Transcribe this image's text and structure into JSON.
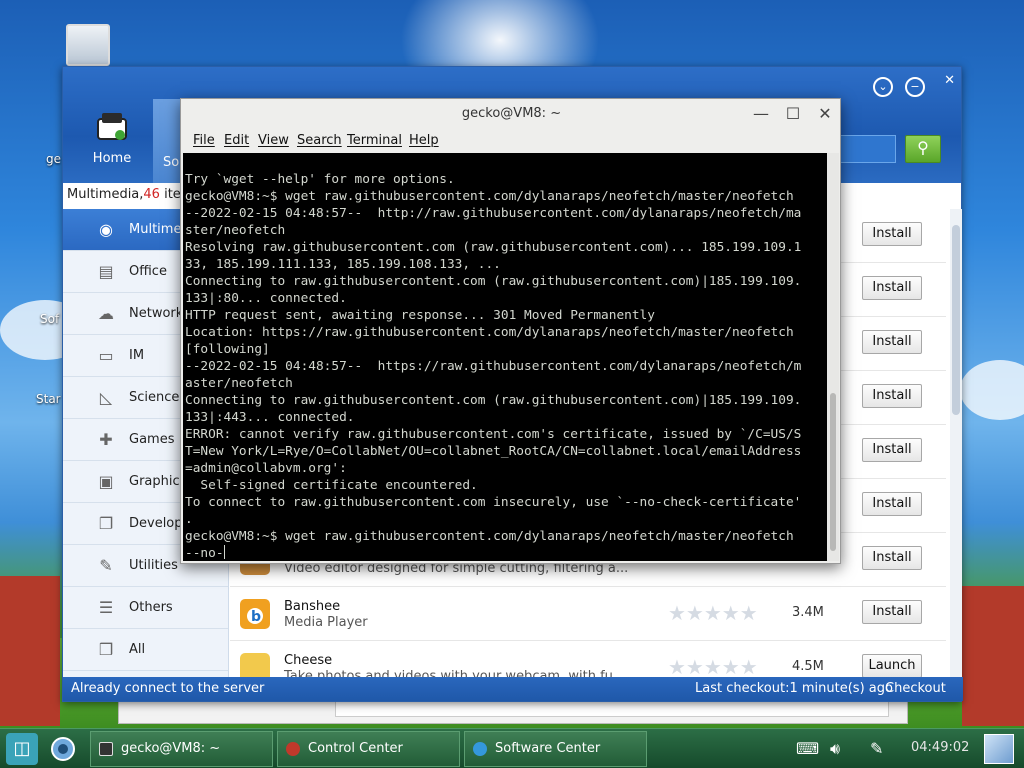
{
  "desktop": {
    "icon_labels": [
      "ge",
      "Sof",
      "Star"
    ]
  },
  "software_center": {
    "home_label": "Home",
    "second_tab_label": "So",
    "category_count_prefix": "Multimedia,",
    "category_count_number": "46",
    "category_count_suffix": " item",
    "sidebar": [
      {
        "label": "Multimedia",
        "icon": "multimedia-icon",
        "active": true
      },
      {
        "label": "Office",
        "icon": "printer-icon"
      },
      {
        "label": "Network",
        "icon": "cloud-icon"
      },
      {
        "label": "IM",
        "icon": "chat-icon"
      },
      {
        "label": "Science-e",
        "icon": "ruler-icon"
      },
      {
        "label": "Games",
        "icon": "gamepad-icon"
      },
      {
        "label": "Graphics",
        "icon": "picture-icon"
      },
      {
        "label": "Develop",
        "icon": "windows-icon"
      },
      {
        "label": "Utilities",
        "icon": "pencil-icon"
      },
      {
        "label": "Others",
        "icon": "list-icon"
      },
      {
        "label": "All",
        "icon": "box-icon"
      }
    ],
    "rows": [
      {
        "name": "",
        "desc": "",
        "size": "",
        "action": "Install"
      },
      {
        "name": "",
        "desc": "",
        "size": "",
        "action": "Install"
      },
      {
        "name": "",
        "desc": "",
        "size": "",
        "action": "Install"
      },
      {
        "name": "",
        "desc": "",
        "size": "",
        "action": "Install"
      },
      {
        "name": "",
        "desc": "",
        "size": "",
        "action": "Install"
      },
      {
        "name": "",
        "desc": "",
        "size": "",
        "action": "Install"
      },
      {
        "name": "",
        "desc": "Video editor designed for simple cutting, filtering a...",
        "size": "",
        "action": "Install"
      },
      {
        "name": "Banshee",
        "desc": "Media Player",
        "size": "3.4M",
        "action": "Install",
        "icon_color": "#f0a020"
      },
      {
        "name": "Cheese",
        "desc": "Take photos and videos with your webcam, with fu...",
        "size": "4.5M",
        "action": "Launch",
        "icon_color": "#f2c94c"
      }
    ],
    "status": {
      "left": "Already connect to the server",
      "right": "Last checkout:1 minute(s) ago",
      "checkout": "Checkout"
    }
  },
  "terminal": {
    "title": "gecko@VM8: ~",
    "menu": [
      "File",
      "Edit",
      "View",
      "Search",
      "Terminal",
      "Help"
    ],
    "lines": [
      "Try `wget --help' for more options.",
      "gecko@VM8:~$ wget raw.githubusercontent.com/dylanaraps/neofetch/master/neofetch",
      "--2022-02-15 04:48:57--  http://raw.githubusercontent.com/dylanaraps/neofetch/ma",
      "ster/neofetch",
      "Resolving raw.githubusercontent.com (raw.githubusercontent.com)... 185.199.109.1",
      "33, 185.199.111.133, 185.199.108.133, ...",
      "Connecting to raw.githubusercontent.com (raw.githubusercontent.com)|185.199.109.",
      "133|:80... connected.",
      "HTTP request sent, awaiting response... 301 Moved Permanently",
      "Location: https://raw.githubusercontent.com/dylanaraps/neofetch/master/neofetch",
      "[following]",
      "--2022-02-15 04:48:57--  https://raw.githubusercontent.com/dylanaraps/neofetch/m",
      "aster/neofetch",
      "Connecting to raw.githubusercontent.com (raw.githubusercontent.com)|185.199.109.",
      "133|:443... connected.",
      "ERROR: cannot verify raw.githubusercontent.com's certificate, issued by `/C=US/S",
      "T=New York/L=Rye/O=CollabNet/OU=collabnet_RootCA/CN=collabnet.local/emailAddress",
      "=admin@collabvm.org':",
      "  Self-signed certificate encountered.",
      "To connect to raw.githubusercontent.com insecurely, use `--no-check-certificate'",
      ".",
      "gecko@VM8:~$ wget raw.githubusercontent.com/dylanaraps/neofetch/master/neofetch",
      "--no-"
    ]
  },
  "taskbar": {
    "tasks": [
      {
        "label": "gecko@VM8: ~",
        "icon": "terminal-icon",
        "color": "#333333"
      },
      {
        "label": "Control Center",
        "icon": "control-center-icon",
        "color": "#c0392b"
      },
      {
        "label": "Software Center",
        "icon": "software-center-icon",
        "color": "#3498db"
      }
    ],
    "clock": "04:49:02"
  }
}
